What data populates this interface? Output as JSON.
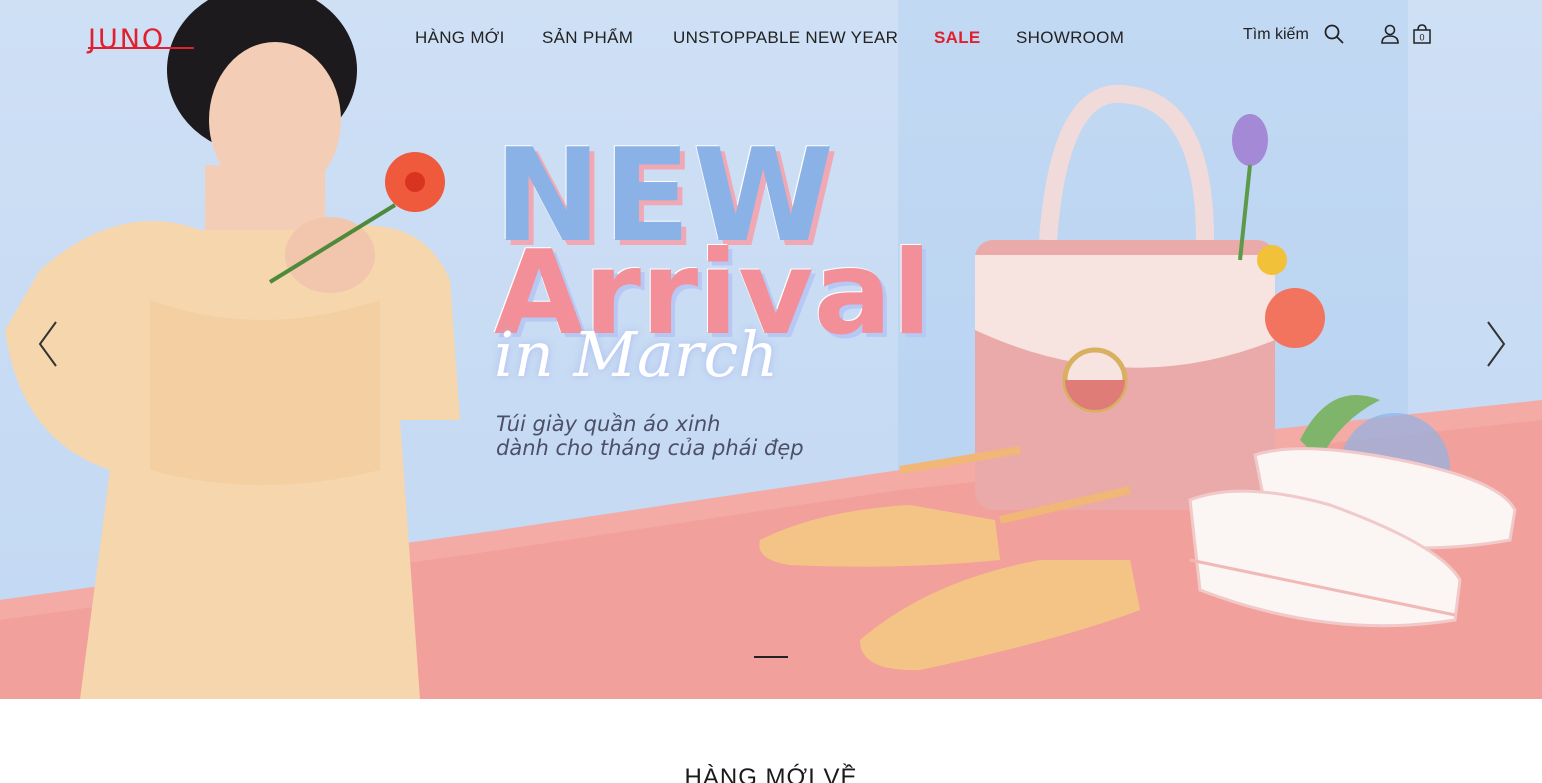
{
  "header": {
    "logo": "JUNO",
    "nav": [
      {
        "label": "HÀNG MỚI"
      },
      {
        "label": "SẢN PHẨM"
      },
      {
        "label": "UNSTOPPABLE NEW YEAR"
      },
      {
        "label": "SALE"
      },
      {
        "label": "SHOWROOM"
      }
    ],
    "search_label": "Tìm kiếm",
    "cart_count": "0"
  },
  "hero": {
    "headline_1": "NEW",
    "headline_2": "Arrival",
    "headline_3": "in March",
    "tagline_line1": "Túi giày quần áo xinh",
    "tagline_line2": "dành cho tháng của phái đẹp",
    "slide_index": 1
  },
  "section": {
    "title": "HÀNG MỚI VỀ"
  },
  "colors": {
    "brand": "#e0202e",
    "sky": "#cfe0f5",
    "floor": "#f2a09b"
  }
}
